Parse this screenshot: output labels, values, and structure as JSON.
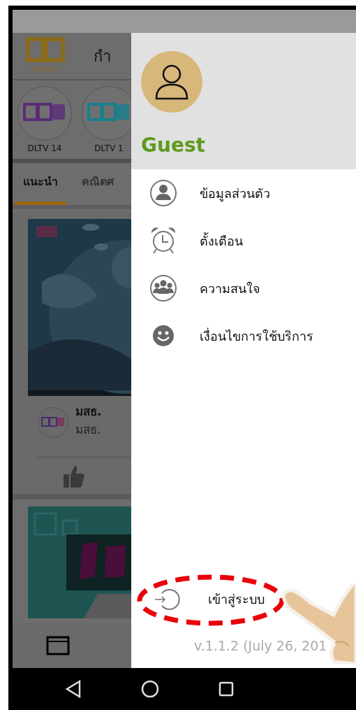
{
  "app": {
    "title": "กำ",
    "channels": [
      {
        "label": "DLTV 14",
        "color": "#5a2c78"
      },
      {
        "label": "DLTV 1",
        "color": "#17808e"
      }
    ],
    "tabs": [
      {
        "label": "แนะนำ",
        "selected": true
      },
      {
        "label": "คณิตศ",
        "selected": false
      }
    ],
    "feed": [
      {
        "kind": "post",
        "title": "มสธ.",
        "subtitle": "มสธ."
      },
      {
        "kind": "picture"
      }
    ]
  },
  "drawer": {
    "user": "Guest",
    "menu": [
      {
        "label": "ข้อมูลส่วนตัว"
      },
      {
        "label": "ตั้งเตือน"
      },
      {
        "label": "ความสนใจ"
      },
      {
        "label": "เงื่อนไขการใช้บริการ"
      }
    ],
    "login": {
      "label": "เข้าสู่ระบบ",
      "highlighted": true
    },
    "version": "v.1.1.2 (July 26, 201"
  }
}
